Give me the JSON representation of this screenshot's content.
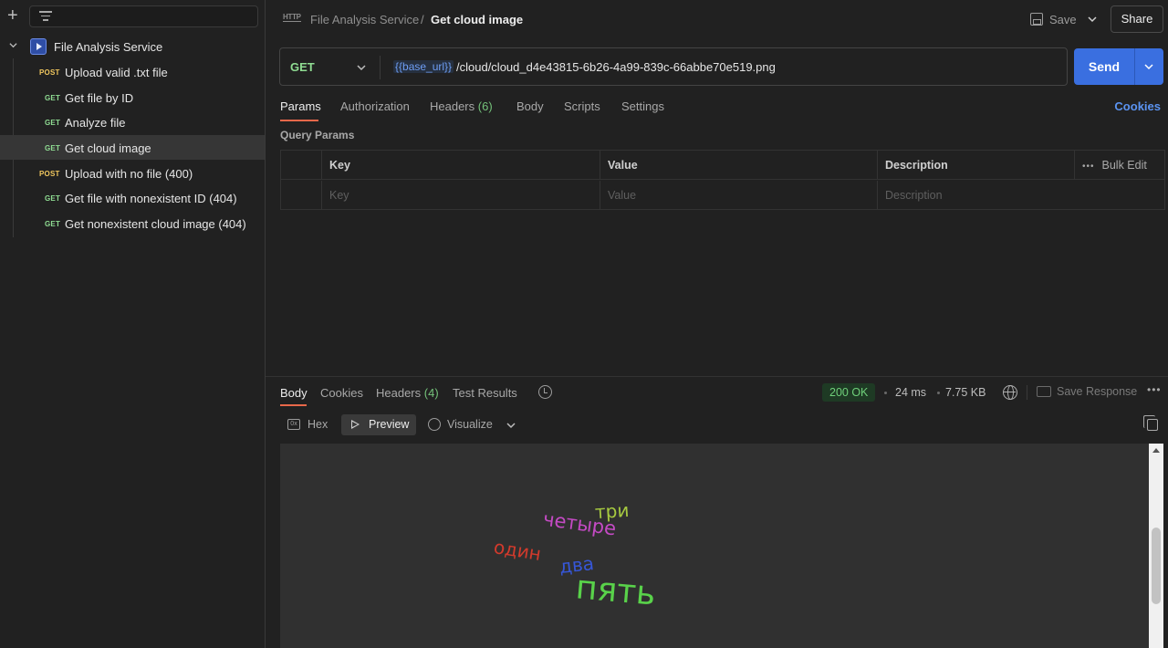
{
  "sidebar": {
    "collection_name": "File Analysis Service",
    "requests": [
      {
        "method": "POST",
        "label": "Upload valid .txt file",
        "active": false
      },
      {
        "method": "GET",
        "label": "Get file by ID",
        "active": false
      },
      {
        "method": "GET",
        "label": "Analyze file",
        "active": false
      },
      {
        "method": "GET",
        "label": "Get cloud image",
        "active": true
      },
      {
        "method": "POST",
        "label": "Upload with no file (400)",
        "active": false
      },
      {
        "method": "GET",
        "label": "Get file with nonexistent ID (404)",
        "active": false
      },
      {
        "method": "GET",
        "label": "Get nonexistent cloud image (404)",
        "active": false
      }
    ]
  },
  "header": {
    "http_badge": "HTTP",
    "breadcrumb_collection": "File Analysis Service",
    "breadcrumb_separator": "/",
    "breadcrumb_request": "Get cloud image",
    "save_label": "Save",
    "share_label": "Share"
  },
  "request": {
    "method": "GET",
    "url_variable": "{{base_url}}",
    "url_path": "/cloud/cloud_d4e43815-6b26-4a99-839c-66abbe70e519.png",
    "send_label": "Send"
  },
  "request_tabs": {
    "params": "Params",
    "authorization": "Authorization",
    "headers": "Headers",
    "headers_count": "(6)",
    "body": "Body",
    "scripts": "Scripts",
    "settings": "Settings",
    "cookies": "Cookies"
  },
  "query_params": {
    "title": "Query Params",
    "columns": [
      "Key",
      "Value",
      "Description"
    ],
    "bulk_edit": "Bulk Edit",
    "placeholders": [
      "Key",
      "Value",
      "Description"
    ]
  },
  "response": {
    "tabs": {
      "body": "Body",
      "cookies": "Cookies",
      "headers": "Headers",
      "headers_count": "(4)",
      "test_results": "Test Results"
    },
    "status": "200 OK",
    "time": "24 ms",
    "size": "7.75 KB",
    "save_response": "Save Response",
    "view_modes": {
      "hex": "Hex",
      "preview": "Preview",
      "visualize": "Visualize"
    },
    "hex_icon_text": "0x",
    "word_cloud": [
      {
        "text": "три",
        "color": "#a6c940"
      },
      {
        "text": "четыре",
        "color": "#c44ac4"
      },
      {
        "text": "один",
        "color": "#d23a2c"
      },
      {
        "text": "два",
        "color": "#3656d6"
      },
      {
        "text": "пять",
        "color": "#59d24a"
      }
    ]
  },
  "colors": {
    "accent_send": "#3a6fe0",
    "get_method": "#8fdc92",
    "post_method": "#f0c75e",
    "status_ok": "#6fd07a",
    "tab_underline": "#e8684a"
  }
}
